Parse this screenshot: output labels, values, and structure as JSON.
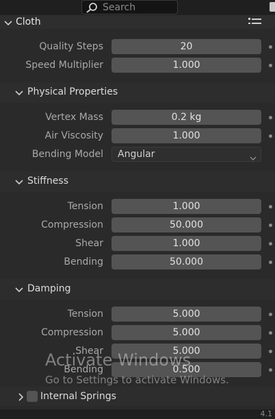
{
  "search": {
    "placeholder": "Search"
  },
  "panel": {
    "title": "Cloth"
  },
  "top_fields": [
    {
      "label": "Quality Steps",
      "value": "20"
    },
    {
      "label": "Speed Multiplier",
      "value": "1.000"
    }
  ],
  "sections": {
    "physical": {
      "title": "Physical Properties",
      "vertex_mass": {
        "label": "Vertex Mass",
        "value": "0.2 kg"
      },
      "air_viscosity": {
        "label": "Air Viscosity",
        "value": "1.000"
      },
      "bending_model": {
        "label": "Bending Model",
        "value": "Angular"
      }
    },
    "stiffness": {
      "title": "Stiffness",
      "fields": [
        {
          "label": "Tension",
          "value": "1.000"
        },
        {
          "label": "Compression",
          "value": "50.000"
        },
        {
          "label": "Shear",
          "value": "1.000"
        },
        {
          "label": "Bending",
          "value": "50.000"
        }
      ]
    },
    "damping": {
      "title": "Damping",
      "fields": [
        {
          "label": "Tension",
          "value": "5.000"
        },
        {
          "label": "Compression",
          "value": "5.000"
        },
        {
          "label": "Shear",
          "value": "5.000"
        },
        {
          "label": "Bending",
          "value": "0.500"
        }
      ]
    },
    "internal_springs": {
      "title": "Internal Springs"
    }
  },
  "watermark": {
    "title": "Activate Windows",
    "subtitle": "Go to Settings to activate Windows."
  },
  "footer": {
    "version": "4.1"
  },
  "icons": {
    "search": "search-icon",
    "list": "list-icon",
    "chevron_down": "chevron-down-icon",
    "chevron_right": "chevron-right-icon"
  },
  "colors": {
    "background": "#2a2a2a",
    "field": "#545454",
    "label": "#a9a9a9",
    "text": "#e2e2e2"
  }
}
